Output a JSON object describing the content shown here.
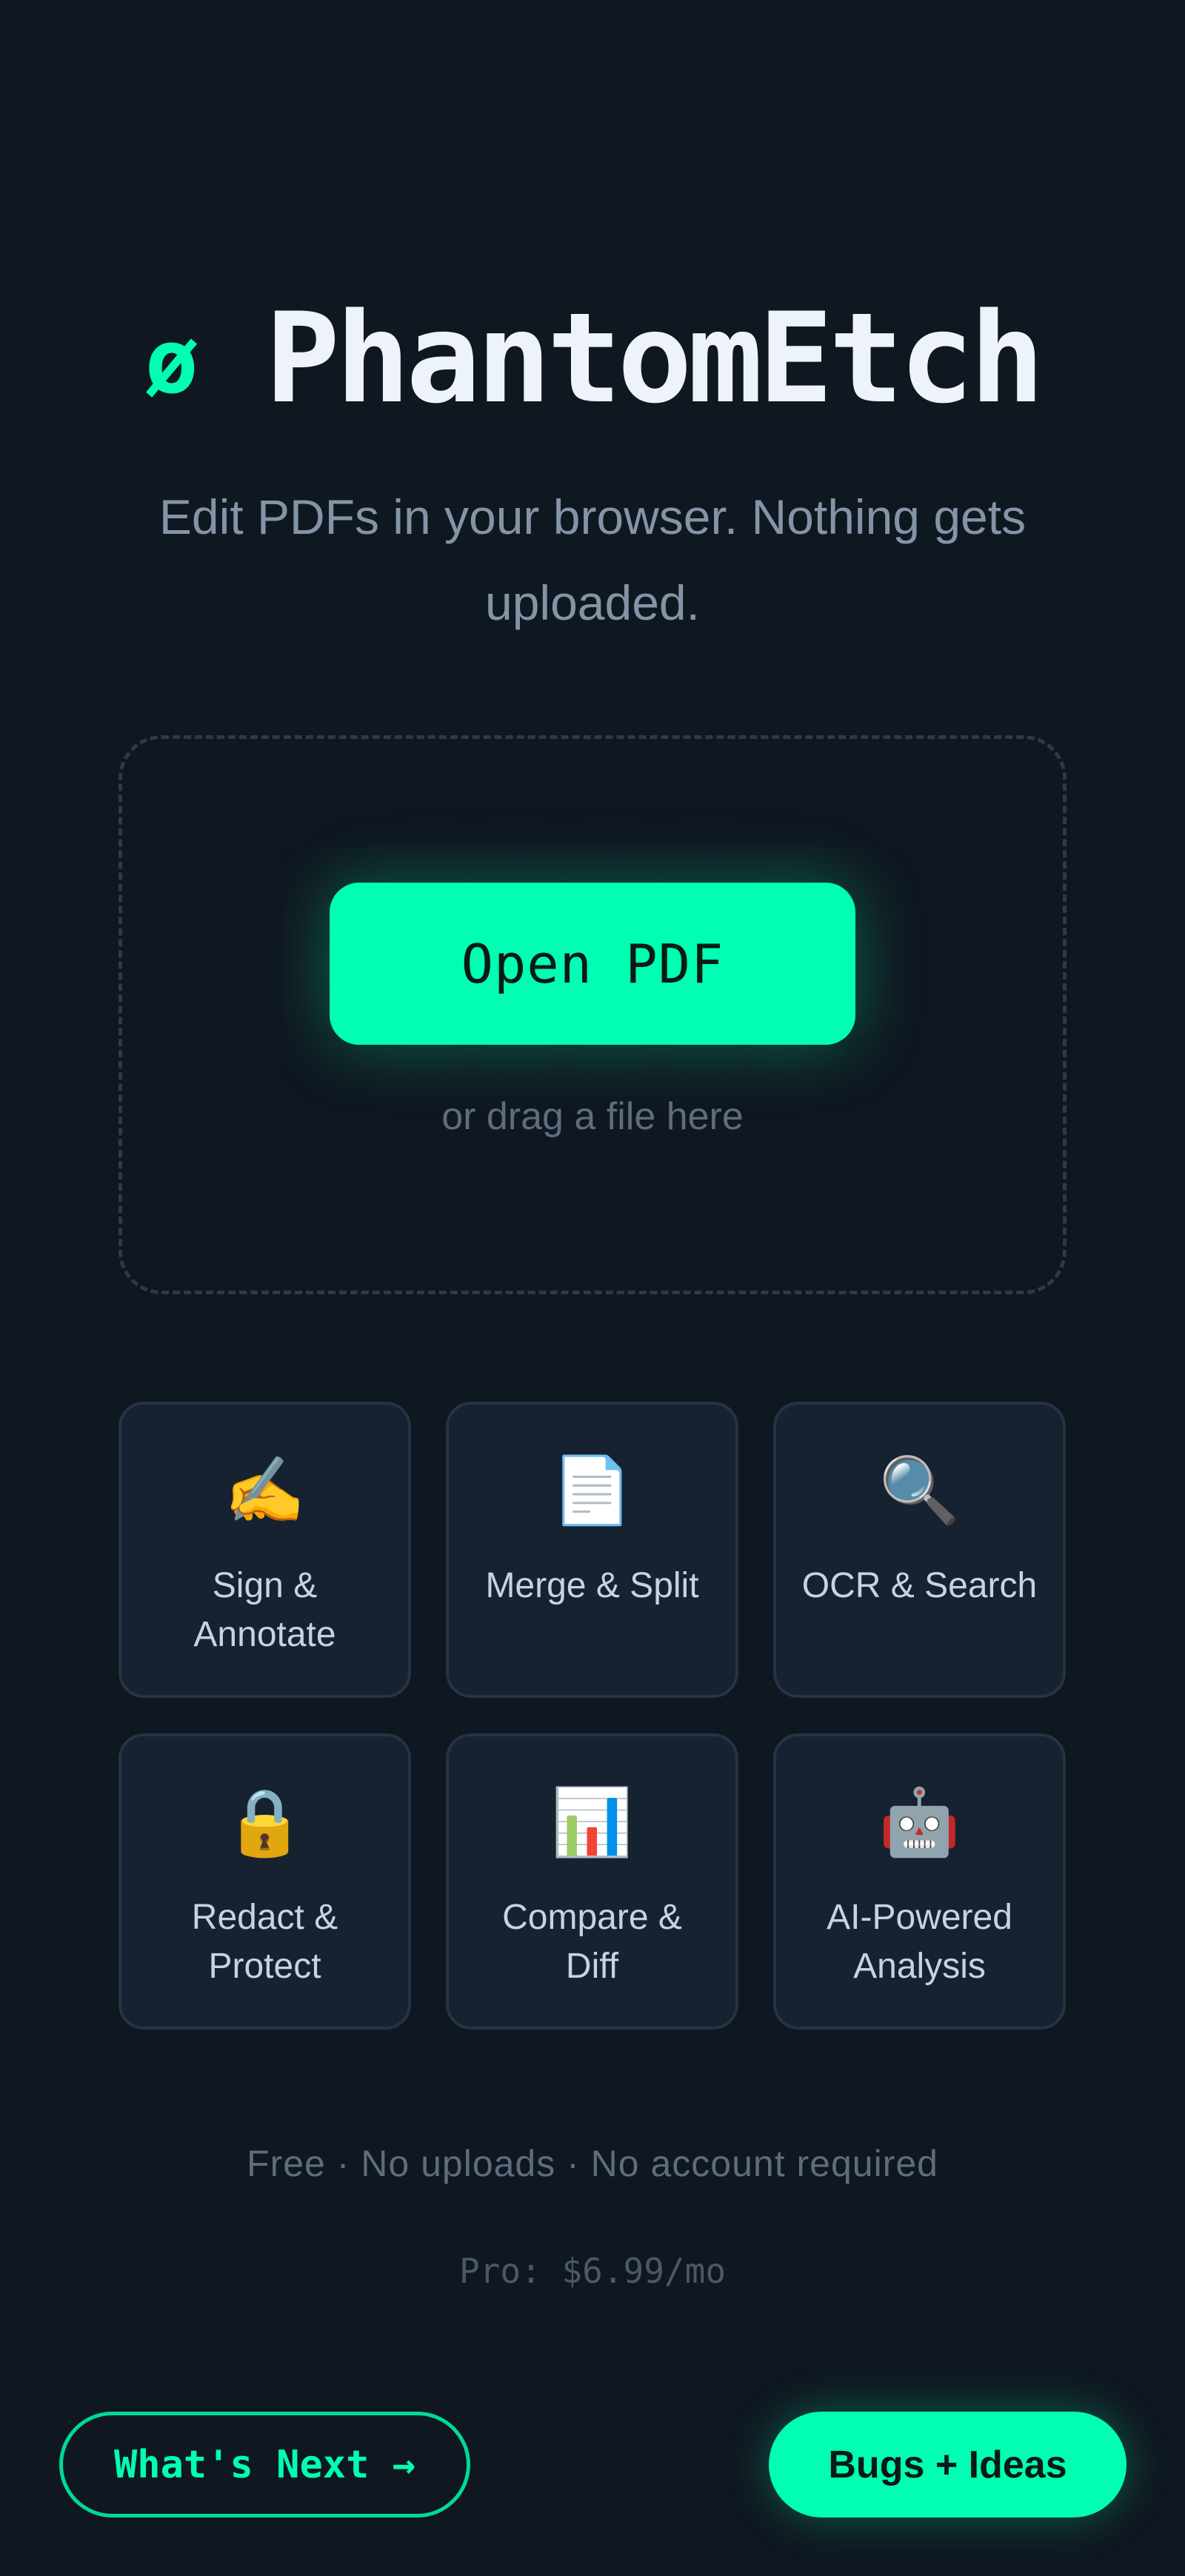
{
  "brand": {
    "glyph": "ø",
    "name": "PhantomEtch"
  },
  "tagline": "Edit PDFs in your browser. Nothing gets uploaded.",
  "dropzone": {
    "open_label": "Open PDF",
    "drag_hint": "or drag a file here"
  },
  "features": [
    {
      "icon": "✍️",
      "icon_name": "writing-hand-icon",
      "label": "Sign & Annotate"
    },
    {
      "icon": "📄",
      "icon_name": "document-icon",
      "label": "Merge & Split"
    },
    {
      "icon": "🔍",
      "icon_name": "magnifier-icon",
      "label": "OCR & Search"
    },
    {
      "icon": "🔒",
      "icon_name": "lock-icon",
      "label": "Redact & Protect"
    },
    {
      "icon": "📊",
      "icon_name": "bar-chart-icon",
      "label": "Compare & Diff"
    },
    {
      "icon": "🤖",
      "icon_name": "robot-icon",
      "label": "AI-Powered Analysis"
    }
  ],
  "meta": "Free · No uploads · No account required",
  "pro": "Pro: $6.99/mo",
  "footer": {
    "next_label": "What's Next →",
    "bugs_label": "Bugs + Ideas"
  },
  "colors": {
    "background": "#0f1720",
    "accent": "#00ffb3",
    "card": "#172230"
  }
}
